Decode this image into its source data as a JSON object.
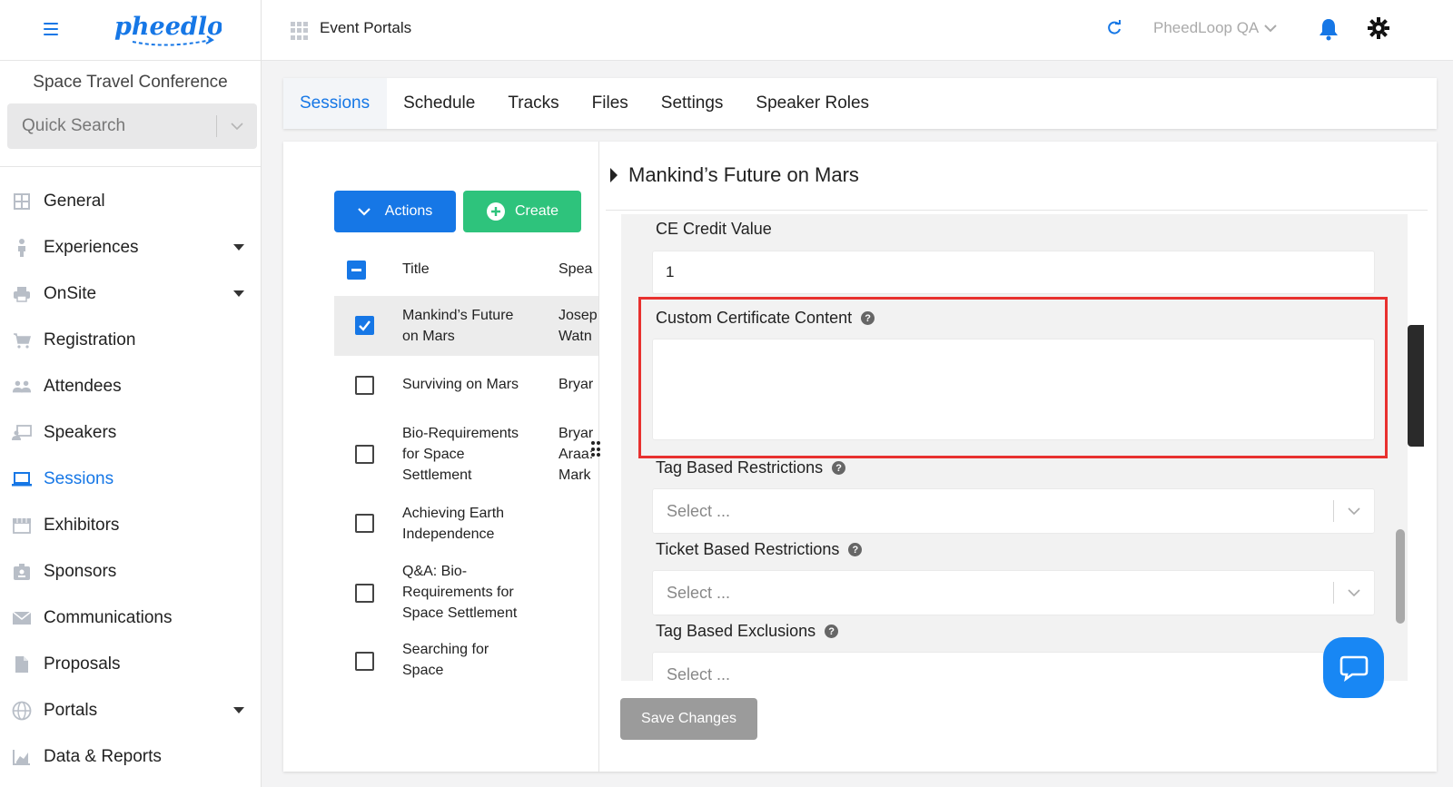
{
  "header": {
    "logo_text": "pheedloop",
    "portals_label": "Event Portals",
    "account_label": "PheedLoop QA"
  },
  "sidebar": {
    "event_name": "Space Travel Conference",
    "quick_search_placeholder": "Quick Search",
    "items": [
      {
        "label": "General",
        "icon": "grid-icon",
        "has_caret": false,
        "active": false
      },
      {
        "label": "Experiences",
        "icon": "person-icon",
        "has_caret": true,
        "active": false
      },
      {
        "label": "OnSite",
        "icon": "printer-icon",
        "has_caret": true,
        "active": false
      },
      {
        "label": "Registration",
        "icon": "cart-icon",
        "has_caret": false,
        "active": false
      },
      {
        "label": "Attendees",
        "icon": "people-icon",
        "has_caret": false,
        "active": false
      },
      {
        "label": "Speakers",
        "icon": "presenter-icon",
        "has_caret": false,
        "active": false
      },
      {
        "label": "Sessions",
        "icon": "laptop-icon",
        "has_caret": false,
        "active": true
      },
      {
        "label": "Exhibitors",
        "icon": "store-icon",
        "has_caret": false,
        "active": false
      },
      {
        "label": "Sponsors",
        "icon": "badge-icon",
        "has_caret": false,
        "active": false
      },
      {
        "label": "Communications",
        "icon": "envelope-icon",
        "has_caret": false,
        "active": false
      },
      {
        "label": "Proposals",
        "icon": "document-icon",
        "has_caret": false,
        "active": false
      },
      {
        "label": "Portals",
        "icon": "globe-icon",
        "has_caret": true,
        "active": false
      },
      {
        "label": "Data & Reports",
        "icon": "chart-icon",
        "has_caret": false,
        "active": false
      }
    ]
  },
  "tabs": [
    "Sessions",
    "Schedule",
    "Tracks",
    "Files",
    "Settings",
    "Speaker Roles"
  ],
  "list": {
    "actions_label": "Actions",
    "create_label": "Create",
    "col_title": "Title",
    "col_speakers": "Spea",
    "rows": [
      {
        "title_1": "Mankind’s Future",
        "title_2": "on Mars",
        "title_3": "",
        "spk_1": "Josep",
        "spk_2": "Watn",
        "spk_3": "",
        "checked": true
      },
      {
        "title_1": "Surviving on Mars",
        "title_2": "",
        "title_3": "",
        "spk_1": "Bryar",
        "spk_2": "",
        "spk_3": "",
        "checked": false
      },
      {
        "title_1": "Bio-Requirements",
        "title_2": "for Space",
        "title_3": "Settlement",
        "spk_1": "Bryar",
        "spk_2": "Araa:",
        "spk_3": "Mark",
        "checked": false
      },
      {
        "title_1": "Achieving Earth",
        "title_2": "Independence",
        "title_3": "",
        "spk_1": "",
        "spk_2": "",
        "spk_3": "",
        "checked": false
      },
      {
        "title_1": "Q&A: Bio-",
        "title_2": "Requirements for",
        "title_3": "Space Settlement",
        "spk_1": "",
        "spk_2": "",
        "spk_3": "",
        "checked": false
      },
      {
        "title_1": "Searching for",
        "title_2": "Space",
        "title_3": "",
        "spk_1": "",
        "spk_2": "",
        "spk_3": "",
        "checked": false
      }
    ]
  },
  "detail": {
    "session_title": "Mankind’s Future on Mars",
    "ce_credit_label": "CE Credit Value",
    "ce_credit_value": "1",
    "custom_cert_label": "Custom Certificate Content",
    "custom_cert_value": "",
    "tag_restrictions_label": "Tag Based Restrictions",
    "tag_restrictions_value": "Select ...",
    "ticket_restrictions_label": "Ticket Based Restrictions",
    "ticket_restrictions_value": "Select ...",
    "tag_exclusions_label": "Tag Based Exclusions",
    "tag_exclusions_value": "Select ...",
    "save_label": "Save Changes"
  },
  "colors": {
    "primary": "#1677e6",
    "create": "#2ec37c",
    "highlight": "#e8312f",
    "chat": "#1887f4"
  }
}
